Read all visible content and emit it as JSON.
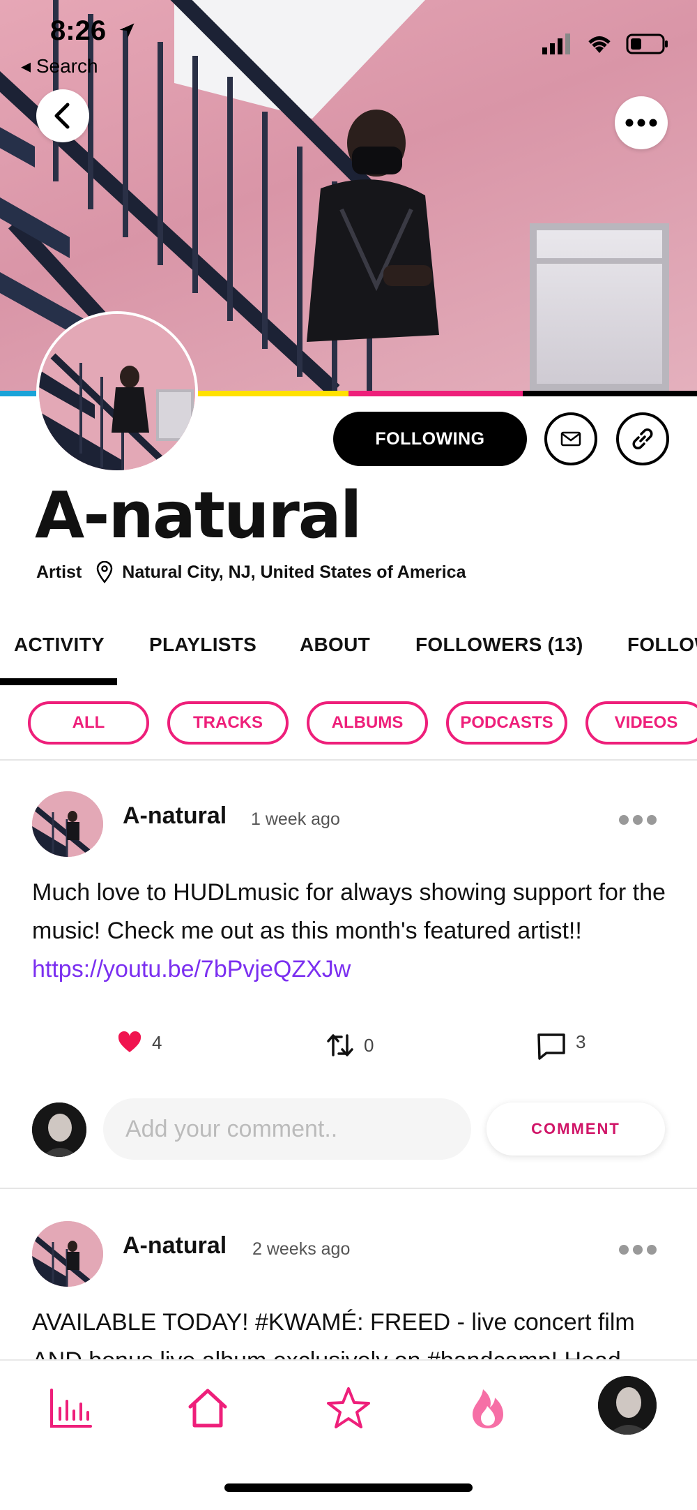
{
  "status_bar": {
    "time": "8:26",
    "back_label": "◂ Search"
  },
  "profile": {
    "name": "A-natural",
    "role": "Artist",
    "location": "Natural City, NJ, United States of America",
    "follow_label": "FOLLOWING",
    "brand_colors": [
      "#1aa3d8",
      "#ffffff",
      "#ffe100",
      "#ee1f7a",
      "#000000"
    ]
  },
  "tabs": [
    "ACTIVITY",
    "PLAYLISTS",
    "ABOUT",
    "FOLLOWERS (13)",
    "FOLLOW"
  ],
  "active_tab": "ACTIVITY",
  "filters": [
    "ALL",
    "TRACKS",
    "ALBUMS",
    "PODCASTS",
    "VIDEOS"
  ],
  "posts": [
    {
      "author": "A-natural",
      "time": "1 week ago",
      "text": "Much love to HUDLmusic for always showing support for the music! Check me out as this month's featured artist!!",
      "link": "https://youtu.be/7bPvjeQZXJw",
      "likes": "4",
      "reposts": "0",
      "comments": "3"
    },
    {
      "author": "A-natural",
      "time": "2 weeks ago",
      "text": "AVAILABLE TODAY! #KWAMÉ: FREED - live concert film AND bonus live album exclusively on #bandcamp! Head"
    }
  ],
  "comment": {
    "placeholder": "Add your comment..",
    "button_label": "COMMENT"
  },
  "accent_color": "#ee1f7a",
  "link_color": "#7b2ff0"
}
